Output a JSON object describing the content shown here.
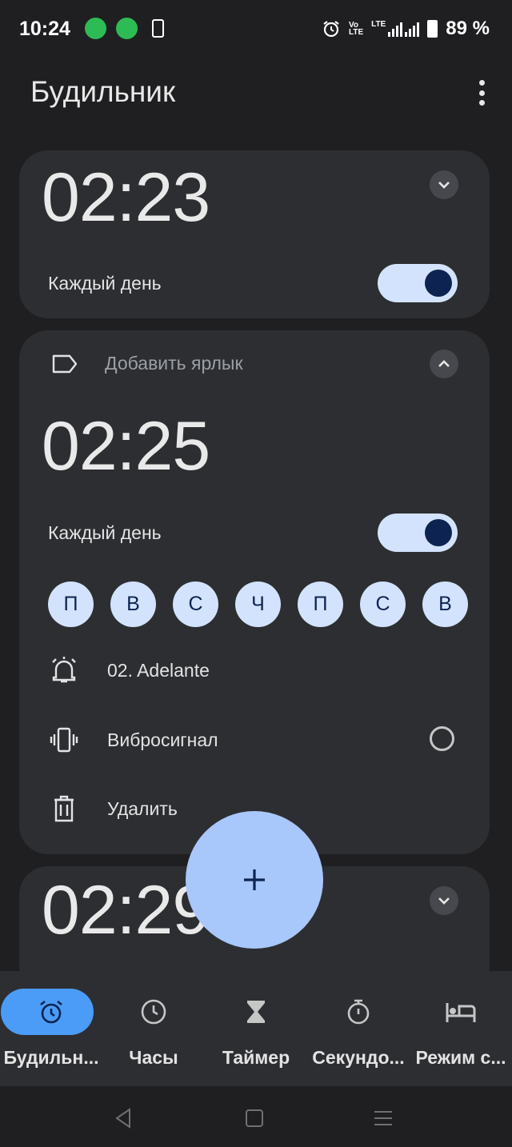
{
  "status_bar": {
    "time": "10:24",
    "battery": "89 %",
    "lte": "LTE",
    "volte_top": "Vo",
    "volte_bottom": "LTE"
  },
  "header": {
    "title": "Будильник"
  },
  "alarms": [
    {
      "time": "02:23",
      "repeat": "Каждый день",
      "enabled": true
    },
    {
      "time": "02:25",
      "repeat": "Каждый день",
      "enabled": true,
      "label_placeholder": "Добавить ярлык",
      "days": [
        "П",
        "В",
        "С",
        "Ч",
        "П",
        "С",
        "В"
      ],
      "ringtone": "02. Adelante",
      "vibration": "Вибросигнал",
      "delete": "Удалить"
    },
    {
      "time": "02:29"
    }
  ],
  "fab": {
    "icon": "plus-icon"
  },
  "bottom_nav": [
    {
      "label": "Будильн...",
      "icon": "alarm-clock-icon",
      "active": true
    },
    {
      "label": "Часы",
      "icon": "clock-icon",
      "active": false
    },
    {
      "label": "Таймер",
      "icon": "hourglass-icon",
      "active": false
    },
    {
      "label": "Секундо...",
      "icon": "stopwatch-icon",
      "active": false
    },
    {
      "label": "Режим с...",
      "icon": "bed-icon",
      "active": false
    }
  ],
  "colors": {
    "accent": "#a8c7fa",
    "toggle_track": "#d3e3fd",
    "toggle_knob": "#0d2452",
    "card": "#2d2e32",
    "nav_active": "#4b9cf6"
  }
}
